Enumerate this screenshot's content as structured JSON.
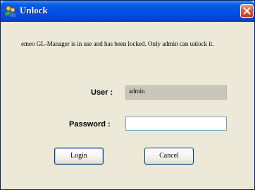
{
  "window": {
    "title": "Unlock",
    "close_icon": "close-icon",
    "app_icon": "users-icon"
  },
  "message": "emeo GL-Manager is in use and has been locked.  Only admin can unlock it.",
  "form": {
    "user_label": "User :",
    "user_value": "admin",
    "password_label": "Password :",
    "password_value": ""
  },
  "buttons": {
    "login_label": "Login",
    "cancel_label": "Cancel"
  },
  "colors": {
    "titlebar": "#0050e6",
    "dialog_bg": "#ece9d8",
    "close_button": "#e25a34"
  }
}
